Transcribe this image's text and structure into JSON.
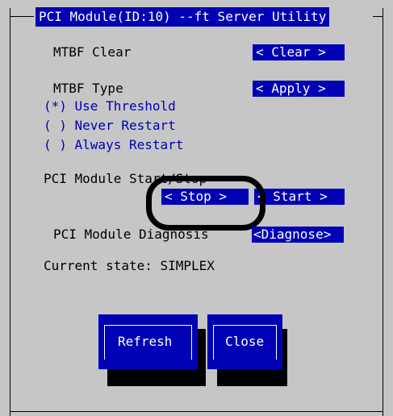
{
  "window": {
    "title": "PCI Module(ID:10) --ft Server Utility"
  },
  "mtbf_clear": {
    "label": "MTBF   Clear",
    "button": "<  Clear >"
  },
  "mtbf_type": {
    "label": "MTBF   Type",
    "button": "<  Apply >",
    "options": [
      {
        "label": "(*) Use Threshold",
        "selected": true
      },
      {
        "label": "( ) Never Restart",
        "selected": false
      },
      {
        "label": "( ) Always Restart",
        "selected": false
      }
    ]
  },
  "start_stop": {
    "label": "PCI Module Start/Stop",
    "stop_button": "<  Stop >",
    "start_button": "<  Start >"
  },
  "diagnosis": {
    "label": "PCI Module Diagnosis",
    "button": "<Diagnose>"
  },
  "state": {
    "text": "Current state: SIMPLEX"
  },
  "footer": {
    "refresh_label": "Refresh",
    "close_label": "Close"
  },
  "colors": {
    "background": "#c6c6c6",
    "accent": "#0000b4",
    "text": "#000000"
  }
}
